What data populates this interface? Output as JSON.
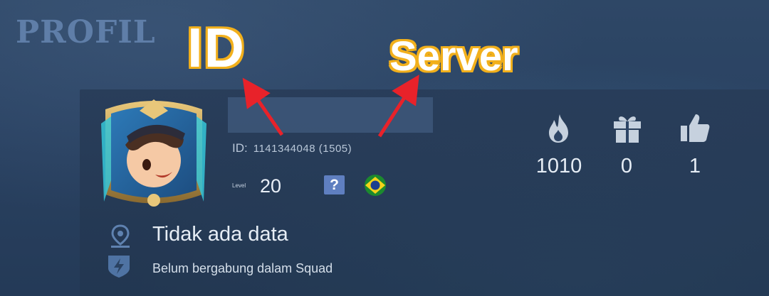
{
  "header": {
    "title": "PROFIL"
  },
  "profile": {
    "id_label": "ID:",
    "id_value": "1141344048",
    "server_value": "(1505)",
    "level_label": "Level",
    "level_value": "20",
    "help_label": "?",
    "flag": "brazil-flag-icon"
  },
  "stats": [
    {
      "icon": "fire-icon",
      "value": "1010"
    },
    {
      "icon": "gift-icon",
      "value": "0"
    },
    {
      "icon": "thumbs-up-icon",
      "value": "1"
    }
  ],
  "info": {
    "location_text": "Tidak ada data",
    "squad_text": "Belum bergabung dalam Squad"
  },
  "annotations": {
    "id_label": "ID",
    "server_label": "Server",
    "arrow_color": "#e8222a",
    "label_outline_color": "#f2b01c"
  },
  "colors": {
    "background": "#2a4262",
    "title": "#5f7ea8",
    "help_badge": "#5f7fc0"
  }
}
